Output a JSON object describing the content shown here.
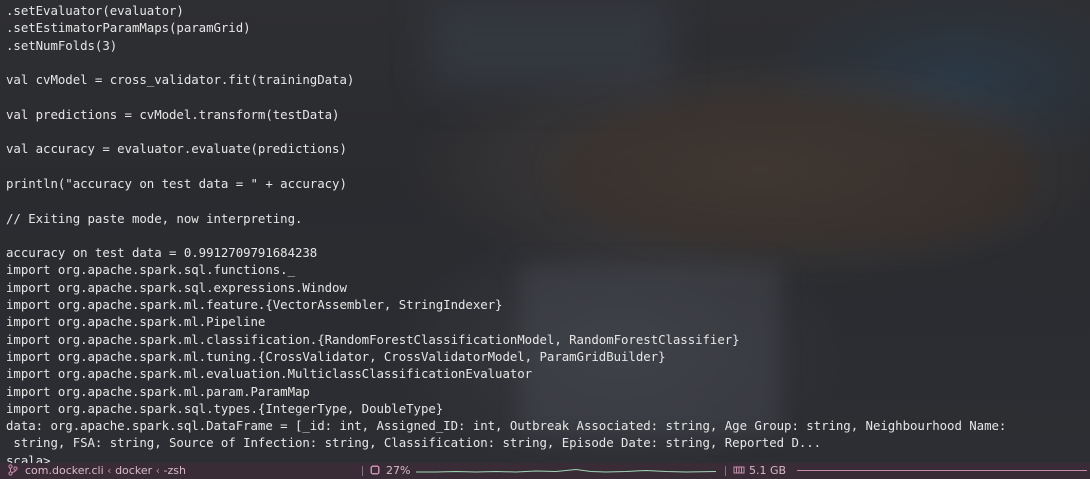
{
  "terminal": {
    "lines": [
      ".setEvaluator(evaluator)",
      ".setEstimatorParamMaps(paramGrid)",
      ".setNumFolds(3)",
      "",
      "val cvModel = cross_validator.fit(trainingData)",
      "",
      "val predictions = cvModel.transform(testData)",
      "",
      "val accuracy = evaluator.evaluate(predictions)",
      "",
      "println(\"accuracy on test data = \" + accuracy)",
      "",
      "// Exiting paste mode, now interpreting.",
      "",
      "accuracy on test data = 0.9912709791684238",
      "import org.apache.spark.sql.functions._",
      "import org.apache.spark.sql.expressions.Window",
      "import org.apache.spark.ml.feature.{VectorAssembler, StringIndexer}",
      "import org.apache.spark.ml.Pipeline",
      "import org.apache.spark.ml.classification.{RandomForestClassificationModel, RandomForestClassifier}",
      "import org.apache.spark.ml.tuning.{CrossValidator, CrossValidatorModel, ParamGridBuilder}",
      "import org.apache.spark.ml.evaluation.MulticlassClassificationEvaluator",
      "import org.apache.spark.ml.param.ParamMap",
      "import org.apache.spark.sql.types.{IntegerType, DoubleType}",
      "data: org.apache.spark.sql.DataFrame = [_id: int, Assigned_ID: int, Outbreak Associated: string, Age Group: string, Neighbourhood Name:",
      " string, FSA: string, Source of Infection: string, Classification: string, Episode Date: string, Reported D..."
    ],
    "prompt": "scala> "
  },
  "statusbar": {
    "branch_icon": "branch-icon",
    "process": "com.docker.cli",
    "sep1": "‹",
    "parent": "docker",
    "sep2": "‹",
    "shell": "-zsh",
    "cpu_icon": "cpu-icon",
    "cpu_percent": "27%",
    "mem_icon": "memory-icon",
    "mem_value": "5.1 GB"
  }
}
